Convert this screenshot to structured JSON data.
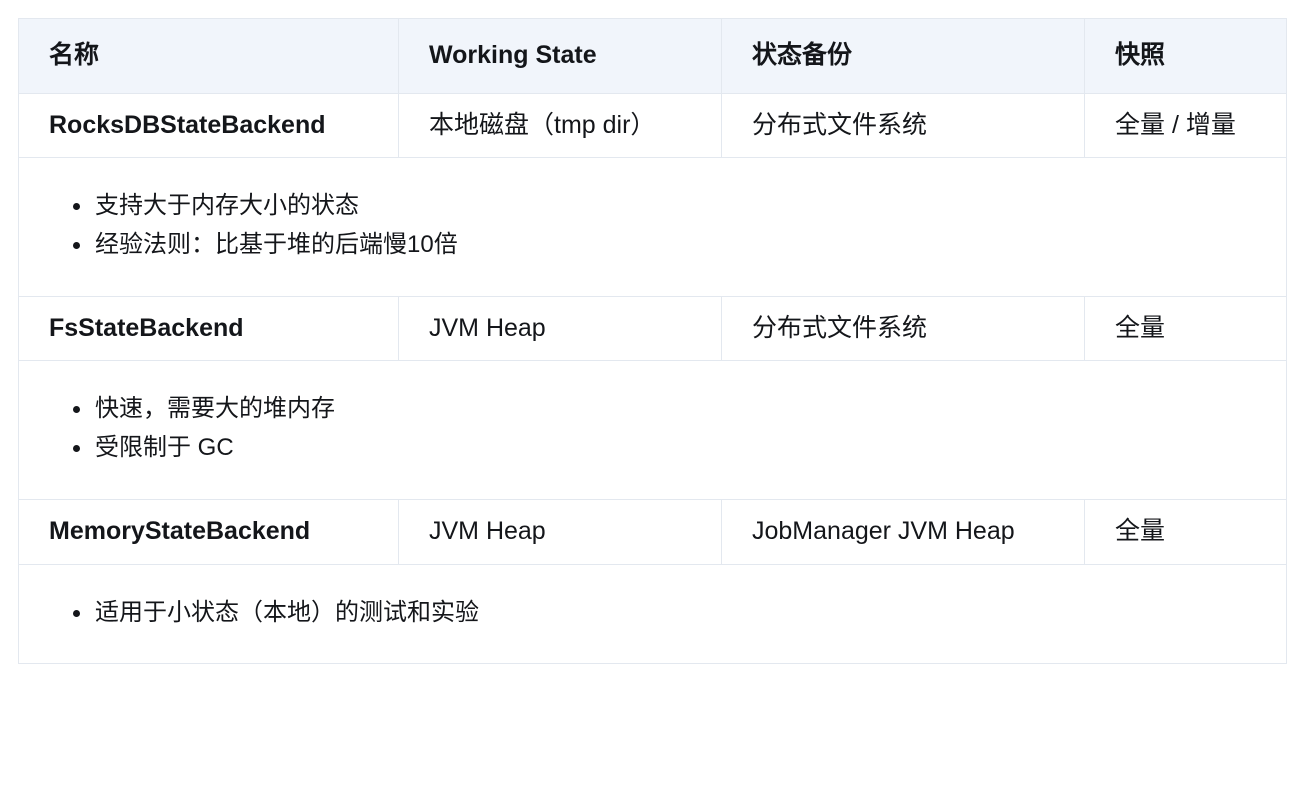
{
  "table": {
    "headers": [
      {
        "label": "名称"
      },
      {
        "label": "Working State"
      },
      {
        "label": "状态备份"
      },
      {
        "label": "快照"
      }
    ],
    "rows": [
      {
        "name": "RocksDBStateBackend",
        "working_state": "本地磁盘（tmp dir）",
        "state_backup": "分布式文件系统",
        "snapshot": "全量 / 增量",
        "notes": [
          "支持大于内存大小的状态",
          "经验法则：比基于堆的后端慢10倍"
        ]
      },
      {
        "name": "FsStateBackend",
        "working_state": "JVM Heap",
        "state_backup": "分布式文件系统",
        "snapshot": "全量",
        "notes": [
          "快速，需要大的堆内存",
          "受限制于 GC"
        ]
      },
      {
        "name": "MemoryStateBackend",
        "working_state": "JVM Heap",
        "state_backup": "JobManager JVM Heap",
        "snapshot": "全量",
        "notes": [
          "适用于小状态（本地）的测试和实验"
        ]
      }
    ]
  },
  "style": {
    "header_background": "#f1f5fb",
    "border_color": "#e3e8ef",
    "text_color": "#14161a",
    "page_background": "#ffffff"
  }
}
